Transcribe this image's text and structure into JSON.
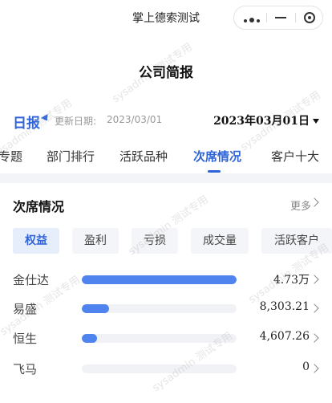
{
  "app": {
    "title": "掌上德索测试"
  },
  "page": {
    "title": "公司简报"
  },
  "report": {
    "type": "日报",
    "update_label": "更新日期:",
    "update_date": "2023/03/01",
    "selected_date": "2023年03月01日"
  },
  "tabs": [
    {
      "label": "专题",
      "active": false
    },
    {
      "label": "部门排行",
      "active": false
    },
    {
      "label": "活跃品种",
      "active": false
    },
    {
      "label": "次席情况",
      "active": true
    },
    {
      "label": "客户十大",
      "active": false
    }
  ],
  "section": {
    "title": "次席情况",
    "more_label": "更多"
  },
  "filters": [
    {
      "label": "权益",
      "active": true
    },
    {
      "label": "盈利",
      "active": false
    },
    {
      "label": "亏损",
      "active": false
    },
    {
      "label": "成交量",
      "active": false
    },
    {
      "label": "活跃客户",
      "active": false
    }
  ],
  "ranking": [
    {
      "name": "金仕达",
      "value": "4.73万",
      "fill": 1.0
    },
    {
      "name": "易盛",
      "value": "8,303.21",
      "fill": 0.175
    },
    {
      "name": "恒生",
      "value": "4,607.26",
      "fill": 0.097
    },
    {
      "name": "飞马",
      "value": "0",
      "fill": 0.0
    }
  ],
  "watermark": {
    "text": "sysadmin 测试专用"
  },
  "colors": {
    "accent": "#2f64d8",
    "bar": "#4f83ee",
    "track": "#f1f2f5",
    "chip_active_bg": "#e6edfb",
    "chip_bg": "#f4f5f8"
  }
}
